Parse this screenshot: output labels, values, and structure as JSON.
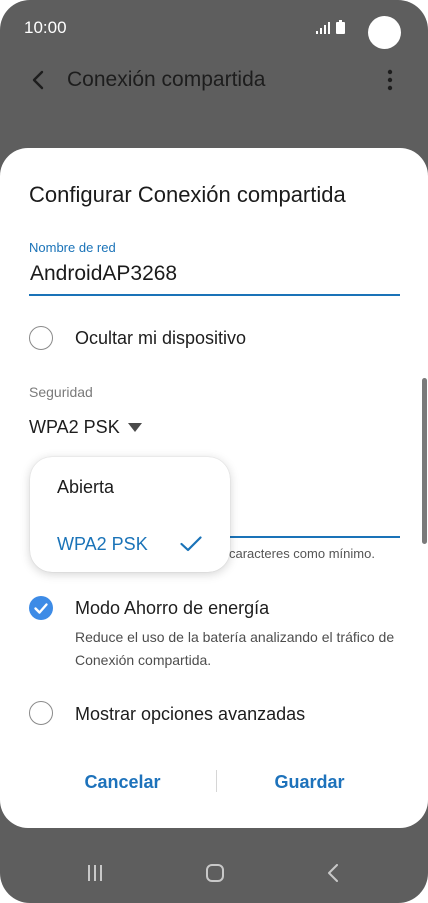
{
  "status_bar": {
    "time": "10:00"
  },
  "app_bar": {
    "title": "Conexión compartida"
  },
  "dialog": {
    "title": "Configurar Conexión compartida",
    "network_name": {
      "label": "Nombre de red",
      "value": "AndroidAP3268"
    },
    "hide_device": {
      "label": "Ocultar mi dispositivo",
      "checked": false
    },
    "security": {
      "label": "Seguridad",
      "value": "WPA2 PSK",
      "options": [
        "Abierta",
        "WPA2 PSK"
      ]
    },
    "password_hint": "caracteres como mínimo.",
    "power_saving": {
      "label": "Modo Ahorro de energía",
      "description": "Reduce el uso de la batería analizando el tráfico de Conexión compartida.",
      "checked": true
    },
    "advanced": {
      "label": "Mostrar opciones avanzadas",
      "checked": false
    },
    "buttons": {
      "cancel": "Cancelar",
      "save": "Guardar"
    }
  },
  "colors": {
    "accent": "#1a73b8",
    "checkbox": "#3d8be6",
    "backdrop": "#5e5e5e"
  },
  "icons": {
    "back": "back-arrow-icon",
    "more": "more-vertical-icon",
    "dropdown": "triangle-down-icon",
    "check": "check-icon"
  }
}
